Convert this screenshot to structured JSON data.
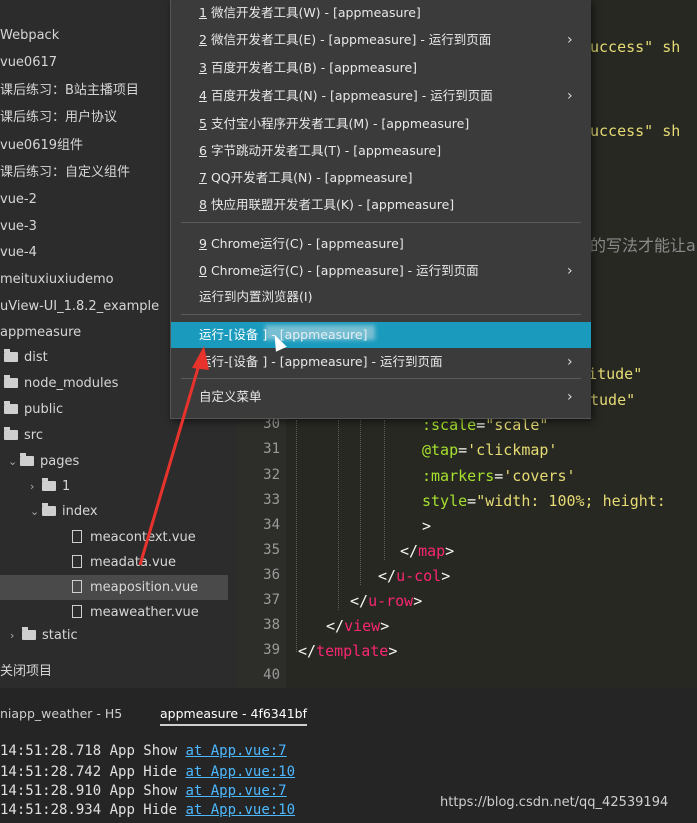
{
  "sidebar": {
    "items": [
      {
        "label": "Webpack",
        "type": "root"
      },
      {
        "label": "vue0617",
        "type": "root"
      },
      {
        "label": "课后练习：B站主播项目",
        "type": "root"
      },
      {
        "label": "课后练习：用户协议",
        "type": "root"
      },
      {
        "label": "vue0619组件",
        "type": "root"
      },
      {
        "label": "课后练习：自定义组件",
        "type": "root"
      },
      {
        "label": "vue-2",
        "type": "root"
      },
      {
        "label": "vue-3",
        "type": "root"
      },
      {
        "label": "vue-4",
        "type": "root"
      },
      {
        "label": "meituxiuxiudemo",
        "type": "root"
      },
      {
        "label": "uView-UI_1.8.2_example",
        "type": "root"
      },
      {
        "label": "appmeasure",
        "type": "root"
      },
      {
        "label": "dist",
        "type": "folder"
      },
      {
        "label": "node_modules",
        "type": "folder"
      },
      {
        "label": "public",
        "type": "folder"
      },
      {
        "label": "src",
        "type": "folder"
      },
      {
        "label": "pages",
        "type": "folder"
      },
      {
        "label": "1",
        "type": "folder"
      },
      {
        "label": "index",
        "type": "folder"
      },
      {
        "label": "meacontext.vue",
        "type": "file"
      },
      {
        "label": "meadata.vue",
        "type": "file"
      },
      {
        "label": "meaposition.vue",
        "type": "file",
        "selected": true
      },
      {
        "label": "meaweather.vue",
        "type": "file"
      },
      {
        "label": "static",
        "type": "folder"
      }
    ],
    "footer": "关闭项目"
  },
  "editor": {
    "line_numbers": [
      "30",
      "31",
      "32",
      "33",
      "34",
      "35",
      "36",
      "37",
      "38",
      "39",
      "40"
    ],
    "peek_top": [
      "uccess\" sh",
      "uccess\" sh",
      "的写法才能让a",
      "ngitude\"",
      "tude\""
    ],
    "lines": [
      {
        "attr": ":scale",
        "eq": "=",
        "val": "\"scale\""
      },
      {
        "attr": "@tap",
        "eq": "=",
        "val": "'clickmap'"
      },
      {
        "attr": ":markers",
        "eq": "=",
        "val": "'covers'"
      },
      {
        "attr": "style",
        "eq": "=",
        "val": "\"width: 100%; height:"
      },
      {
        "text": ">"
      },
      {
        "open": "</",
        "tag": "map",
        "close": ">"
      },
      {
        "open": "</",
        "tag": "u-col",
        "close": ">"
      },
      {
        "open": "</",
        "tag": "u-row",
        "close": ">"
      },
      {
        "open": "</",
        "tag": "view",
        "close": ">"
      },
      {
        "open": "</",
        "tag": "template",
        "close": ">"
      }
    ]
  },
  "menu": {
    "items": [
      {
        "num": "1",
        "label": "微信开发者工具(W) - [appmeasure]",
        "submenu": false
      },
      {
        "num": "2",
        "label": "微信开发者工具(E) - [appmeasure] - 运行到页面",
        "submenu": true
      },
      {
        "num": "3",
        "label": "百度开发者工具(B) - [appmeasure]",
        "submenu": false
      },
      {
        "num": "4",
        "label": "百度开发者工具(N) - [appmeasure] - 运行到页面",
        "submenu": true
      },
      {
        "num": "5",
        "label": "支付宝小程序开发者工具(M) - [appmeasure]",
        "submenu": false
      },
      {
        "num": "6",
        "label": "字节跳动开发者工具(T) - [appmeasure]",
        "submenu": false
      },
      {
        "num": "7",
        "label": "QQ开发者工具(N) - [appmeasure]",
        "submenu": false
      },
      {
        "num": "8",
        "label": "快应用联盟开发者工具(K) - [appmeasure]",
        "submenu": false
      },
      {
        "num": "9",
        "label": "Chrome运行(C) - [appmeasure]",
        "submenu": false
      },
      {
        "num": "0",
        "label": "Chrome运行(C) - [appmeasure] - 运行到页面",
        "submenu": true
      },
      {
        "num": "",
        "label": "运行到内置浏览器(I)",
        "submenu": false
      },
      {
        "num": "",
        "label": "运行-[设备              ] - [appmeasure]",
        "submenu": false,
        "highlight": true
      },
      {
        "num": "",
        "label": "运行-[设备              ] - [appmeasure] - 运行到页面",
        "submenu": true
      },
      {
        "num": "",
        "label": "自定义菜单",
        "submenu": true
      }
    ]
  },
  "console": {
    "tabs": [
      {
        "label": "niapp_weather - H5",
        "active": false
      },
      {
        "label": "appmeasure - 4f6341bf",
        "active": true
      }
    ],
    "logs": [
      {
        "time": "14:51:28.718",
        "event": "App Show",
        "link": "at App.vue:7"
      },
      {
        "time": "14:51:28.742",
        "event": "App Hide",
        "link": "at App.vue:10"
      },
      {
        "time": "14:51:28.910",
        "event": "App Show",
        "link": "at App.vue:7"
      },
      {
        "time": "14:51:28.934",
        "event": "App Hide",
        "link": "at App.vue:10"
      }
    ]
  },
  "watermark": "https://blog.csdn.net/qq_42539194",
  "colors": {
    "highlight": "#1a9bbd",
    "annotation_arrow": "#e8322c",
    "tag": "#f92672",
    "attr": "#a6e22e",
    "string": "#e6db74",
    "link": "#4db8ff"
  }
}
